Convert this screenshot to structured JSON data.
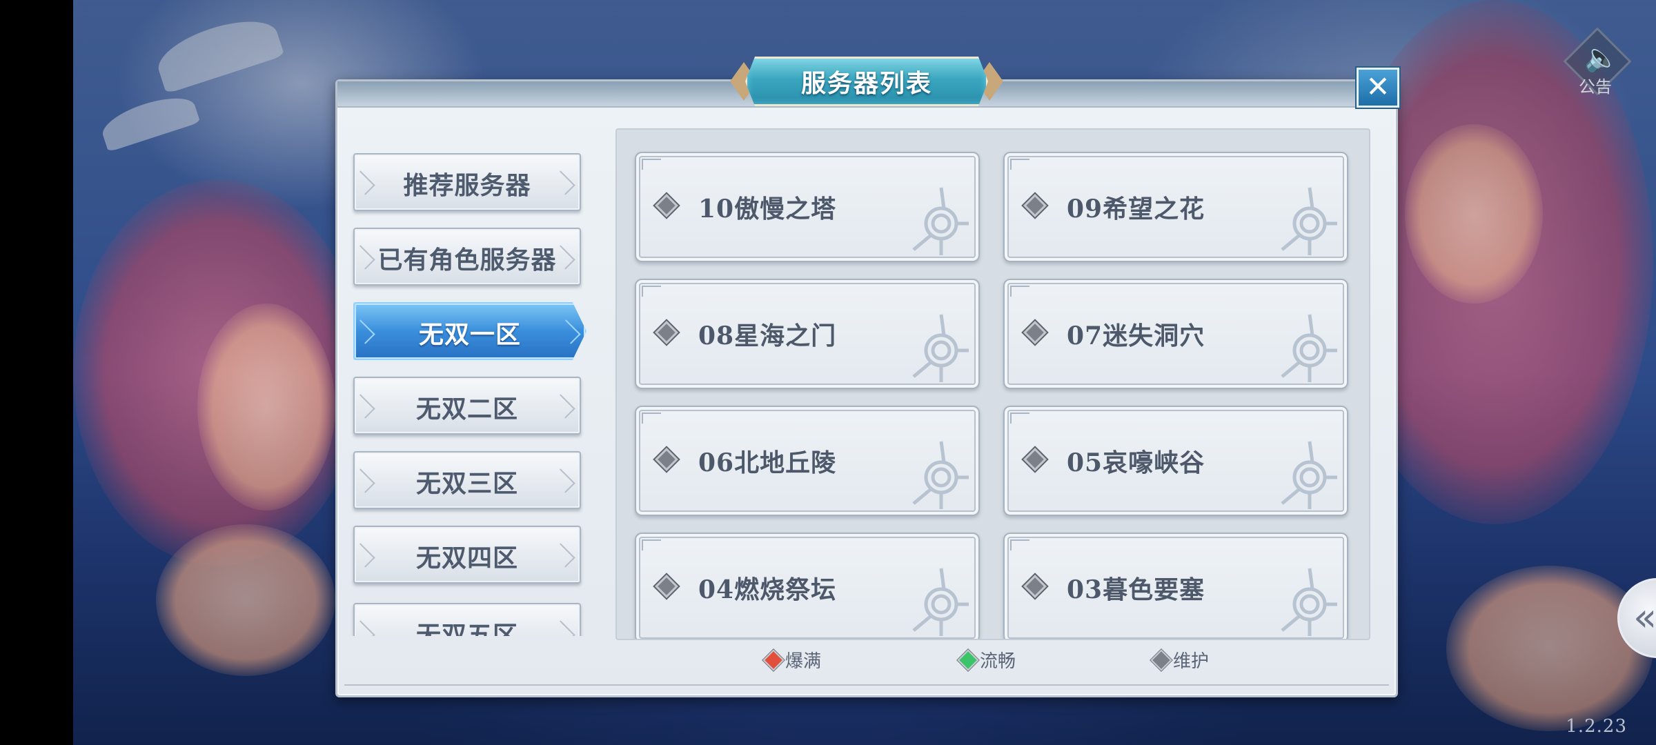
{
  "window": {
    "title": "服务器列表",
    "notice_label": "公告",
    "version": "1.2.23"
  },
  "sidebar": {
    "items": [
      {
        "label": "推荐服务器",
        "active": false
      },
      {
        "label": "已有角色服务器",
        "active": false
      },
      {
        "label": "无双一区",
        "active": true
      },
      {
        "label": "无双二区",
        "active": false
      },
      {
        "label": "无双三区",
        "active": false
      },
      {
        "label": "无双四区",
        "active": false
      },
      {
        "label": "无双五区",
        "active": false
      }
    ]
  },
  "servers": [
    {
      "name": "10傲慢之塔",
      "status": "maintenance"
    },
    {
      "name": "09希望之花",
      "status": "maintenance"
    },
    {
      "name": "08星海之门",
      "status": "maintenance"
    },
    {
      "name": "07迷失洞穴",
      "status": "maintenance"
    },
    {
      "name": "06北地丘陵",
      "status": "maintenance"
    },
    {
      "name": "05哀嚎峡谷",
      "status": "maintenance"
    },
    {
      "name": "04燃烧祭坛",
      "status": "maintenance"
    },
    {
      "name": "03暮色要塞",
      "status": "maintenance"
    }
  ],
  "legend": [
    {
      "label": "爆满",
      "color": "#e0503c"
    },
    {
      "label": "流畅",
      "color": "#3cc46a"
    },
    {
      "label": "维护",
      "color": "#7c8189"
    }
  ],
  "colors": {
    "status_full": "#e0503c",
    "status_smooth": "#3cc46a",
    "status_maintenance": "#7c8189",
    "active_tab": "#3a8fdc",
    "title_plate": "#3aa6bf"
  },
  "icons": {
    "close": "close-icon",
    "notice": "speaker-icon",
    "side_tab": "double-chevron-left-icon",
    "card_emblem": "spiral-sun-emblem-icon"
  }
}
